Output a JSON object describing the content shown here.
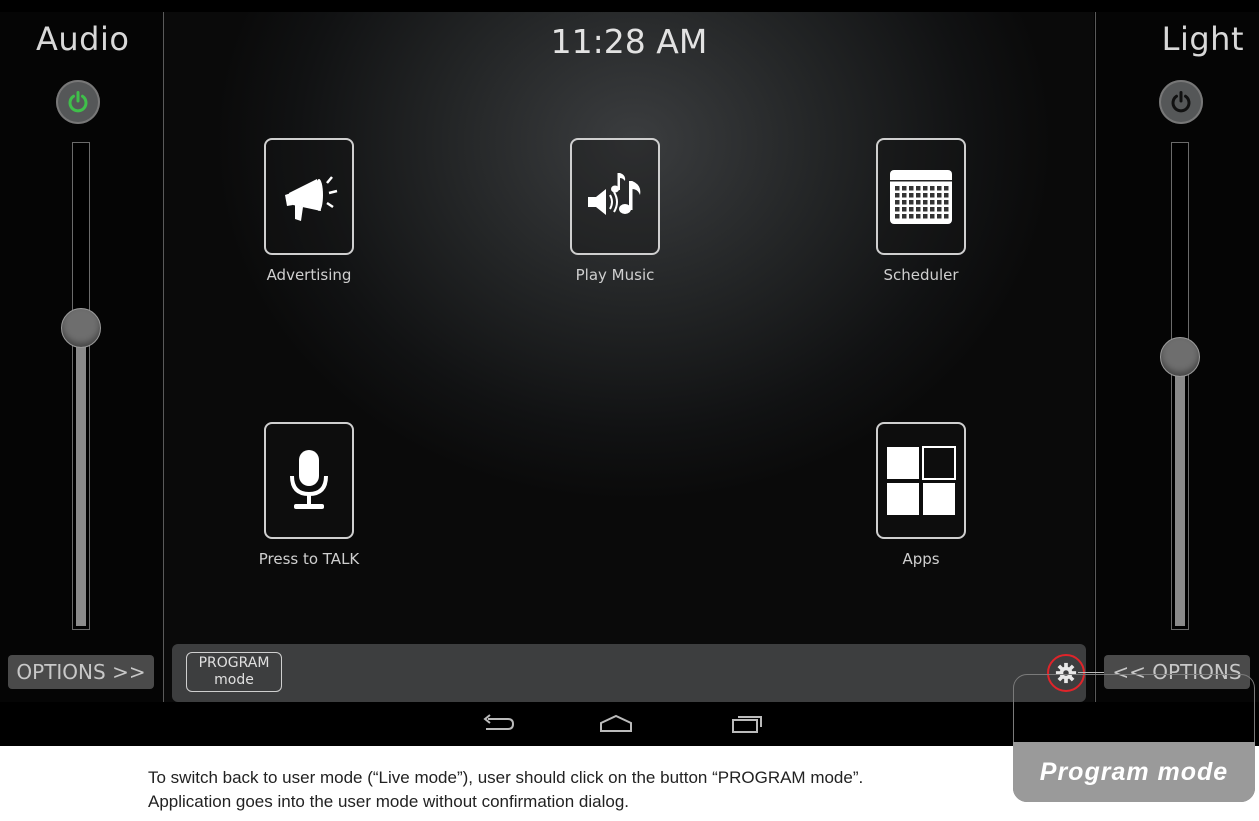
{
  "clock": "11:28 AM",
  "audio_panel": {
    "title": "Audio",
    "power_icon": "power-icon",
    "power_color": "#3fbf4a",
    "level": 0.62,
    "options_label": "OPTIONS >>"
  },
  "light_panel": {
    "title": "Light",
    "power_icon": "power-icon",
    "power_color": "#111111",
    "level": 0.56,
    "options_label": "<< OPTIONS"
  },
  "tiles": [
    {
      "label": "Advertising",
      "icon": "megaphone-icon"
    },
    {
      "label": "Play Music",
      "icon": "music-note-icon"
    },
    {
      "label": "Scheduler",
      "icon": "calendar-icon"
    },
    {
      "label": "Press to TALK",
      "icon": "microphone-icon"
    },
    {
      "label": "Apps",
      "icon": "apps-grid-icon"
    }
  ],
  "bottom_bar": {
    "program_line1": "PROGRAM",
    "program_line2": "mode",
    "settings_icon": "gear-icon",
    "highlight_color": "#e0242a"
  },
  "nav": {
    "back_icon": "back-icon",
    "home_icon": "home-icon",
    "recents_icon": "recents-icon"
  },
  "callout_label": "Program mode",
  "caption_lines": [
    "To switch back to user mode (“Live mode”), user should click on the button “PROGRAM mode”.",
    "Application goes into the user mode without confirmation dialog."
  ]
}
